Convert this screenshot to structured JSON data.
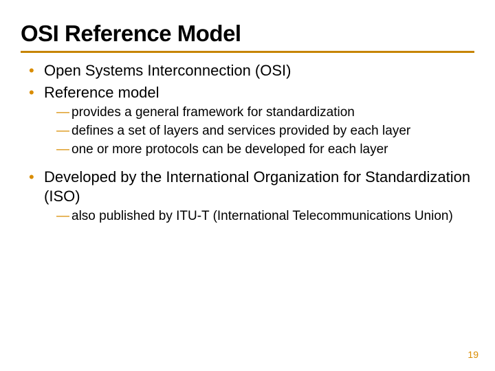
{
  "title": "OSI Reference Model",
  "bullets": {
    "b1": "Open Systems Interconnection (OSI)",
    "b2": "Reference model",
    "b2_sub1": "provides a general framework for standardization",
    "b2_sub2": "defines a set of layers and services provided by each layer",
    "b2_sub3": "one or more protocols can be developed for each layer",
    "b3": "Developed by the International Organization for Standardization (ISO)",
    "b3_sub1": "also published by ITU-T (International Telecommunications Union)"
  },
  "page_number": "19"
}
